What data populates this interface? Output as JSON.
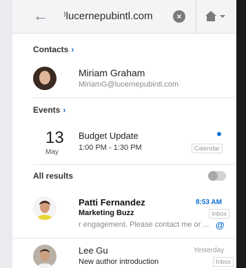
{
  "search": {
    "query": "⁾lucernepubintl.com",
    "clear_glyph": "×"
  },
  "contacts": {
    "heading": "Contacts",
    "items": [
      {
        "name": "Miriam Graham",
        "email": "MiriamG@lucernepubintl.com"
      }
    ]
  },
  "events": {
    "heading": "Events",
    "items": [
      {
        "day": "13",
        "month": "May",
        "title": "Budget Update",
        "time": "1:00 PM - 1:30 PM",
        "folder": "Calendar"
      }
    ]
  },
  "results": {
    "heading": "All results",
    "items": [
      {
        "sender": "Patti Fernandez",
        "subject": "Marketing Buzz",
        "preview": "r engagement. Please contact me or ...",
        "time": "8:53 AM",
        "folder": "Inbox",
        "unread": true,
        "mention": "@"
      },
      {
        "sender": "Lee Gu",
        "subject": "New author introduction",
        "time": "Yesterday",
        "folder": "Inbox",
        "unread": false
      }
    ]
  },
  "colors": {
    "accent": "#0a6ed1",
    "background": "#ffffff",
    "search_bar": "#f3f4f6"
  },
  "icons": {
    "back": "arrow-left-icon",
    "clear": "clear-circle-icon",
    "home": "home-icon",
    "dropdown": "chevron-down-icon",
    "toggle": "attachment-toggle-icon",
    "event_indicator": "dot-icon",
    "mention": "at-icon"
  }
}
